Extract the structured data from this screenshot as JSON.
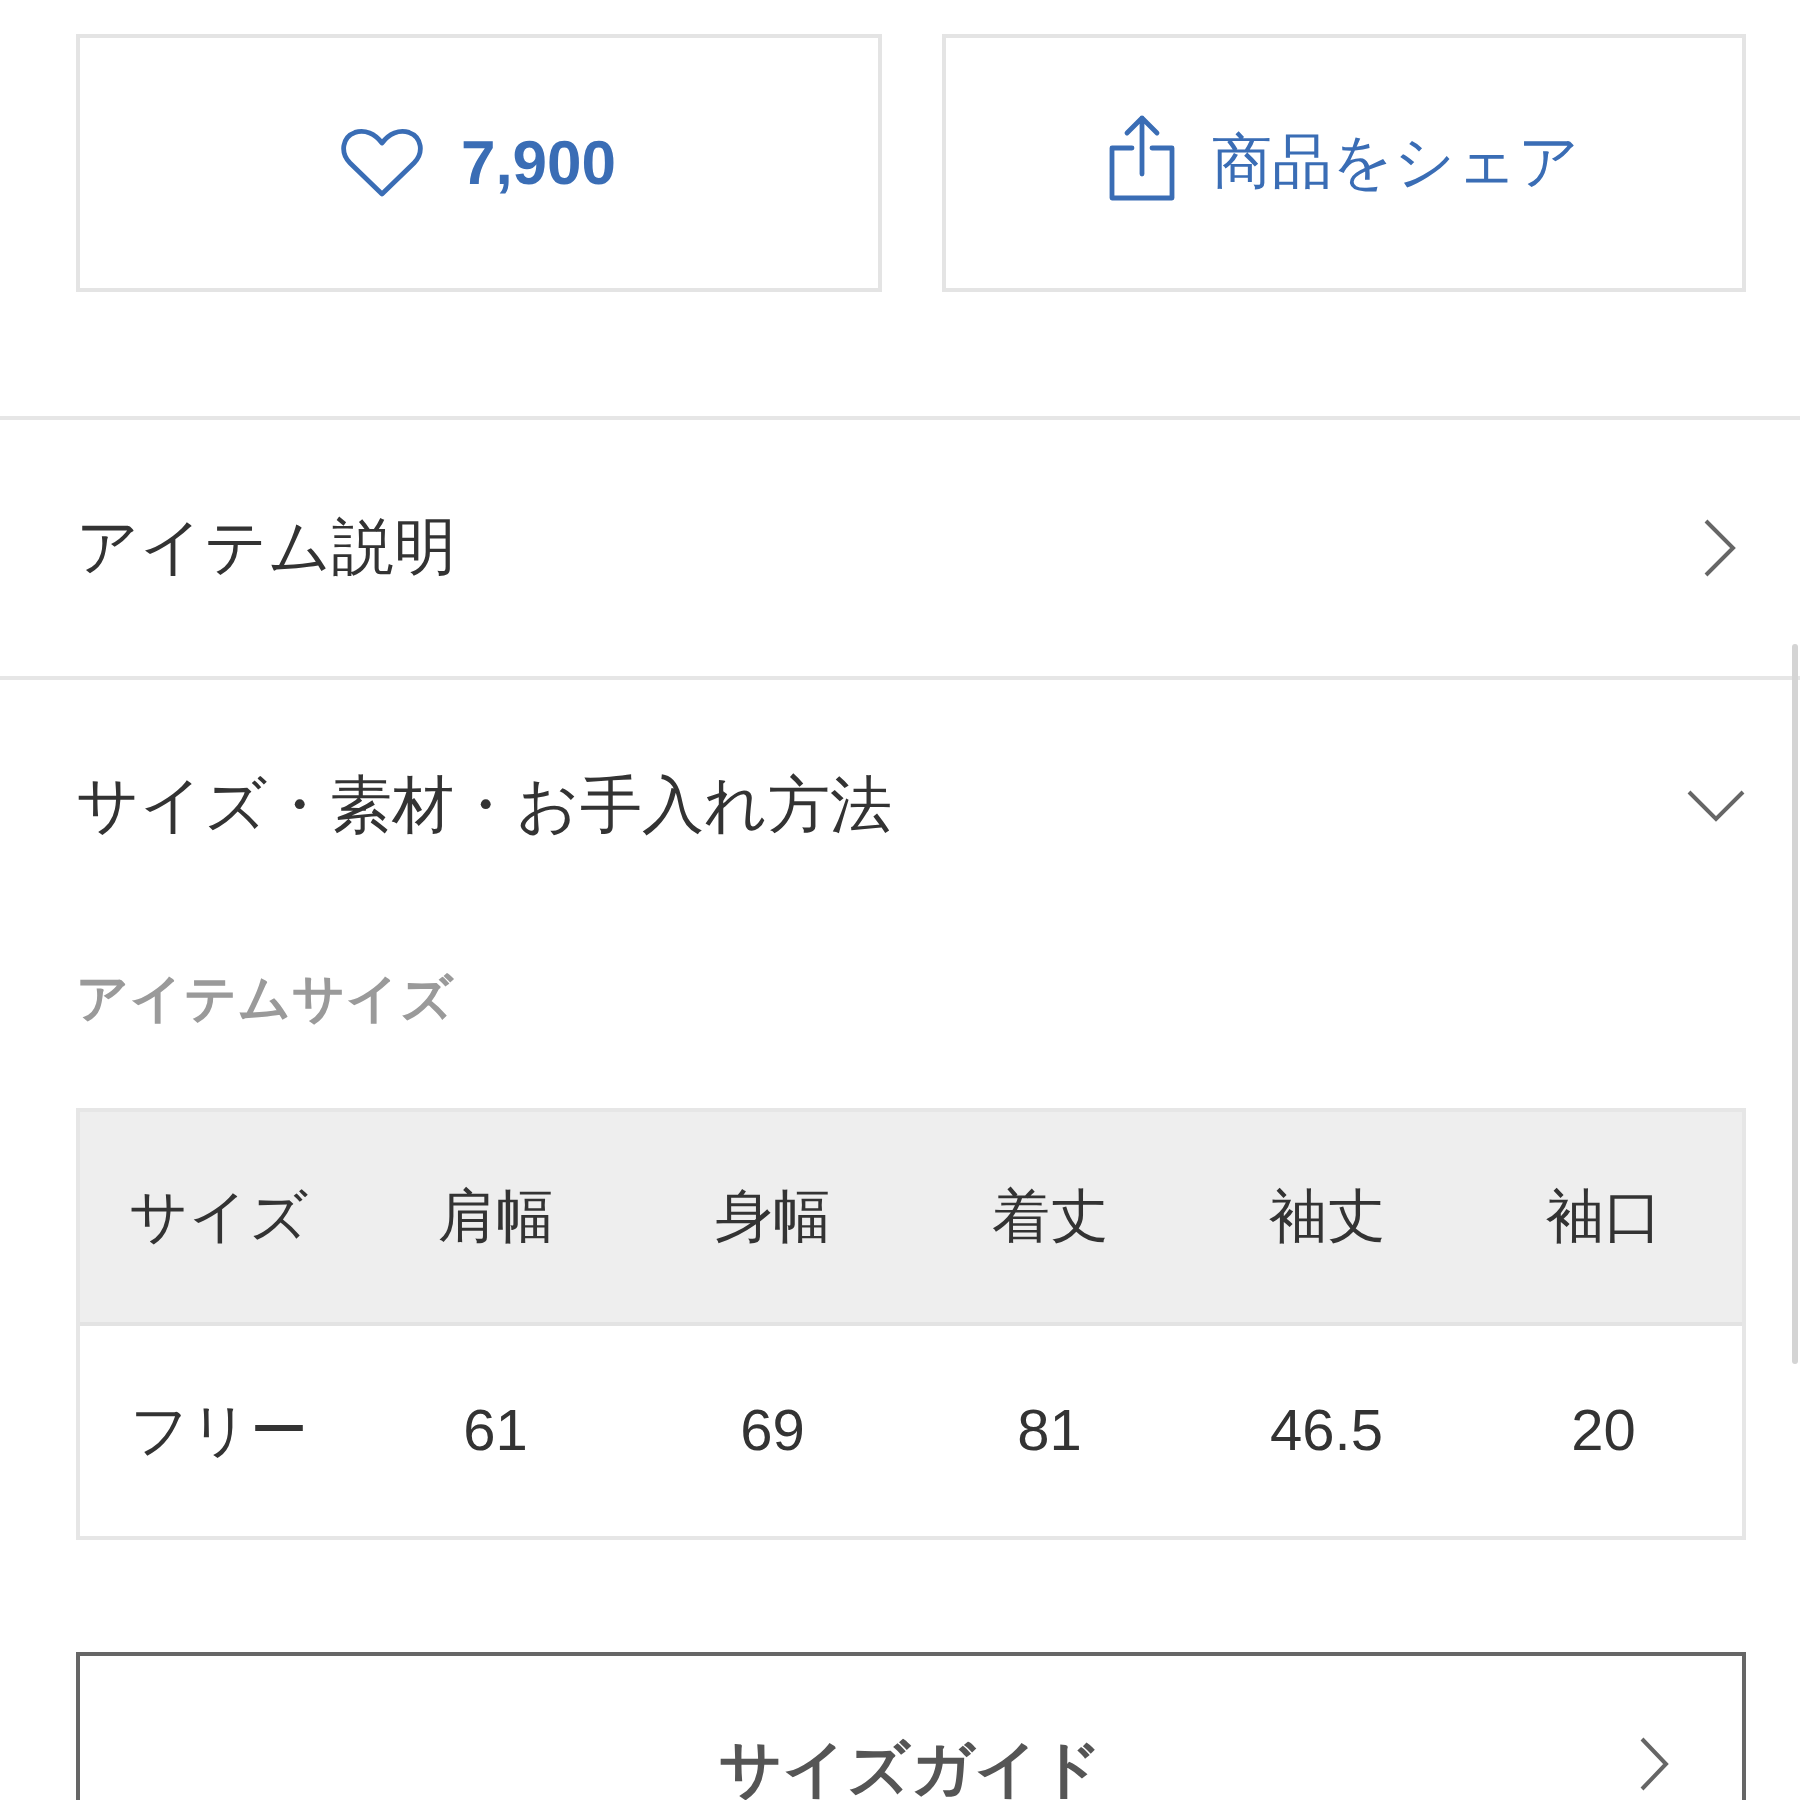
{
  "actions": [
    {
      "kind": "like",
      "label": "7,900"
    },
    {
      "kind": "share",
      "label": "商品をシェア"
    }
  ],
  "sections": [
    {
      "title": "アイテム説明",
      "expanded": false
    },
    {
      "title": "サイズ・素材・お手入れ方法",
      "expanded": true,
      "content": {
        "heading": "アイテムサイズ",
        "table": {
          "columns": [
            "サイズ",
            "肩幅",
            "身幅",
            "着丈",
            "袖丈",
            "袖口"
          ],
          "rows": [
            [
              "フリー",
              "61",
              "69",
              "81",
              "46.5",
              "20"
            ]
          ]
        }
      }
    }
  ],
  "size_guide_button": {
    "label": "サイズガイド"
  }
}
